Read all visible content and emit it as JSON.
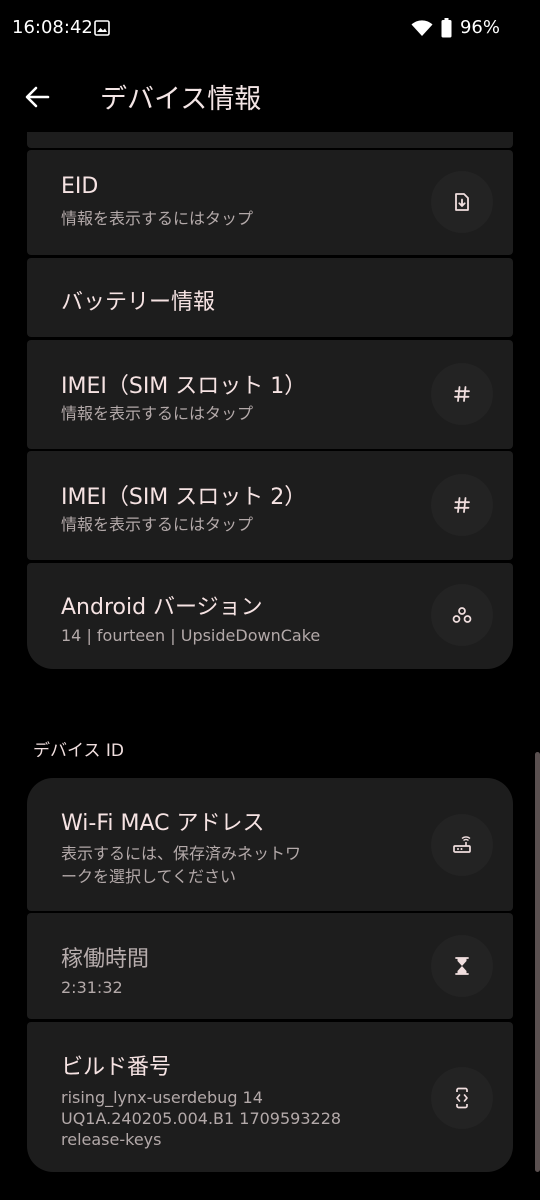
{
  "status_bar": {
    "time": "16:08:42",
    "battery": "96%",
    "icons": [
      "image-icon",
      "wifi-icon",
      "battery-icon"
    ]
  },
  "app_bar": {
    "title": "デバイス情報",
    "back_icon": "arrow-back-icon"
  },
  "items": [
    {
      "title": "EID",
      "subtitle": "情報を表示するにはタップ",
      "icon": "sim-download-icon"
    },
    {
      "title": "バッテリー情報"
    },
    {
      "title": "IMEI（SIM スロット 1）",
      "subtitle": "情報を表示するにはタップ",
      "icon": "hash-icon"
    },
    {
      "title": "IMEI（SIM スロット 2）",
      "subtitle": "情報を表示するにはタップ",
      "icon": "hash-icon"
    },
    {
      "title": "Android バージョン",
      "subtitle": "14 | fourteen | UpsideDownCake",
      "icon": "android-version-icon"
    }
  ],
  "device_id_section": {
    "header": "デバイス ID",
    "items": [
      {
        "title": "Wi-Fi MAC アドレス",
        "subtitle_line1": "表示するには、保存済みネットワ",
        "subtitle_line2": "ークを選択してください",
        "icon": "router-icon"
      },
      {
        "title": "稼働時間",
        "subtitle": "2:31:32",
        "icon": "hourglass-icon"
      },
      {
        "title": "ビルド番号",
        "subtitle_line1": "rising_lynx-userdebug 14",
        "subtitle_line2": "UQ1A.240205.004.B1 1709593228",
        "subtitle_line3": "release-keys",
        "icon": "developer-mode-icon"
      }
    ]
  },
  "colors": {
    "background": "#000000",
    "card": "#1d1d1d",
    "title": "#f6e3e3",
    "subtitle": "#b3a9a9"
  }
}
